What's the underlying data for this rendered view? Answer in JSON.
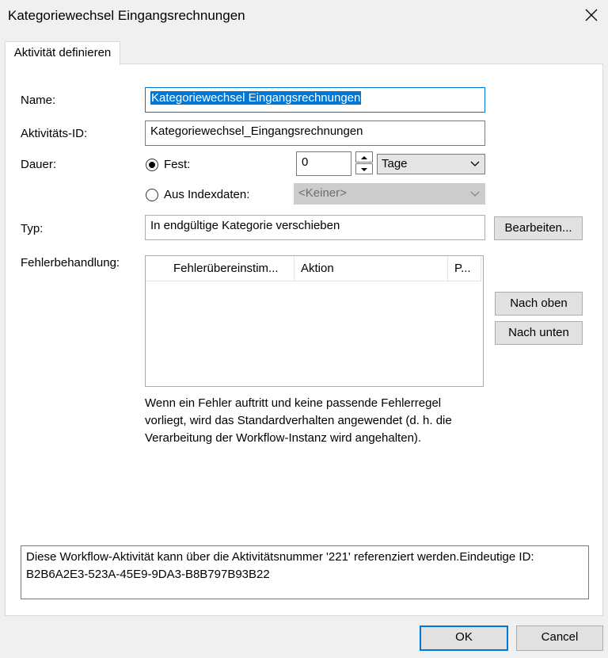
{
  "window": {
    "title": "Kategoriewechsel Eingangsrechnungen",
    "close_icon": "close-icon"
  },
  "tab": {
    "label": "Aktivität definieren"
  },
  "form": {
    "name_label": "Name:",
    "name_value": "Kategoriewechsel Eingangsrechnungen",
    "id_label": "Aktivitäts-ID:",
    "id_value": "Kategoriewechsel_Eingangsrechnungen",
    "duration_label": "Dauer:",
    "fixed_label": "Fest:",
    "fixed_selected": true,
    "fixed_value": "0",
    "unit_value": "Tage",
    "index_label": "Aus Indexdaten:",
    "index_value": "<Keiner>",
    "type_label": "Typ:",
    "type_value": "In endgültige Kategorie verschieben",
    "edit_button": "Bearbeiten...",
    "error_label": "Fehlerbehandlung:",
    "grid_columns": [
      "Fehlerübereinstim...",
      "Aktion",
      "P..."
    ],
    "up_button": "Nach oben",
    "down_button": "Nach unten",
    "info_text": "Wenn ein Fehler auftritt und keine passende Fehlerregel vorliegt, wird das Standardverhalten angewendet (d. h. die Verarbeitung der Workflow-Instanz wird angehalten).",
    "id_info_line1": "Diese Workflow-Aktivität kann über die Aktivitätsnummer '221' referenziert werden.Eindeutige ID:",
    "id_info_line2": "B2B6A2E3-523A-45E9-9DA3-B8B797B93B22"
  },
  "footer": {
    "ok": "OK",
    "cancel": "Cancel"
  }
}
